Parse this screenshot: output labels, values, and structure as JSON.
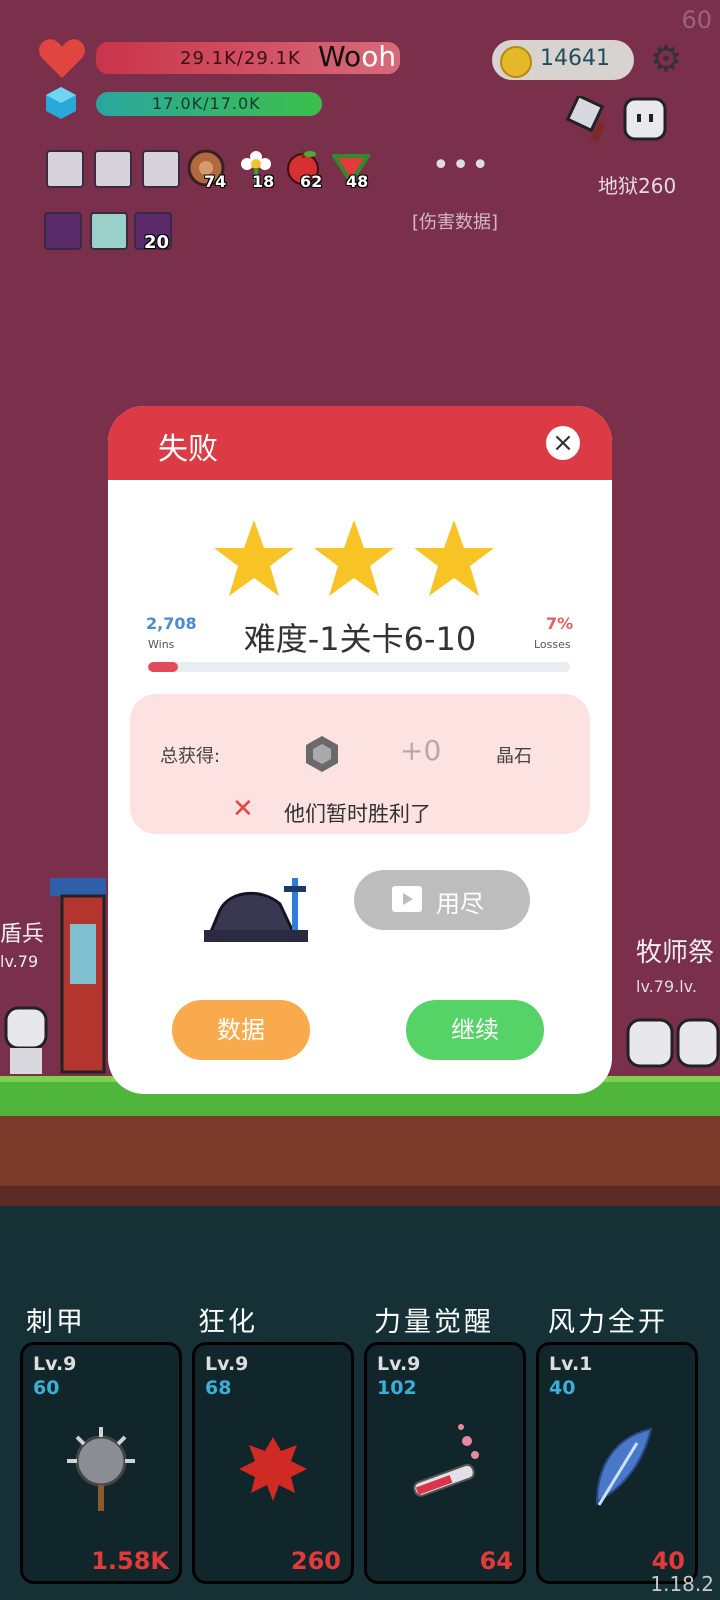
{
  "fps": "60",
  "hud": {
    "hp_text": "29.1K/29.1K",
    "wooh_prefix": "Wo",
    "wooh_suffix": "oh",
    "mp_text": "17.0K/17.0K",
    "coins": "14641",
    "item_counts": [
      "74",
      "18",
      "62",
      "48"
    ],
    "buff_count": "20",
    "more": "•••",
    "damage_data": "[伤害数据]",
    "hell_level": "地狱260"
  },
  "dialog": {
    "title": "失败",
    "close": "×",
    "stars": 3,
    "wins_value": "2,708",
    "wins_label": "Wins",
    "stage": "难度-1关卡6-10",
    "losses_value": "7%",
    "losses_label": "Losses",
    "loss_fraction": 0.07,
    "reward_label": "总获得:",
    "reward_amount": "+0",
    "reward_name": "晶石",
    "result_message": "他们暂时胜利了",
    "ad_button": "用尽",
    "data_button": "数据",
    "continue_button": "继续"
  },
  "battle": {
    "left_label": "盾兵",
    "left_level": "lv.79",
    "right_label": "牧师祭",
    "right_level": "lv.79.lv."
  },
  "skills": [
    {
      "name": "刺甲",
      "level": "Lv.9",
      "value": "60",
      "cost": "1.58K",
      "icon": "spiked-mace-icon"
    },
    {
      "name": "狂化",
      "level": "Lv.9",
      "value": "68",
      "cost": "260",
      "icon": "blood-splat-icon"
    },
    {
      "name": "力量觉醒",
      "level": "Lv.9",
      "value": "102",
      "cost": "64",
      "icon": "potion-vial-icon"
    },
    {
      "name": "风力全开",
      "level": "Lv.1",
      "value": "40",
      "cost": "40",
      "icon": "feather-icon"
    }
  ],
  "version": "1.18.2",
  "colors": {
    "background": "#7a2f4a",
    "dialog_header": "#dc3a45",
    "data_button": "#f9aa4c",
    "continue_button": "#56d366",
    "cost_text": "#e23a3a"
  }
}
